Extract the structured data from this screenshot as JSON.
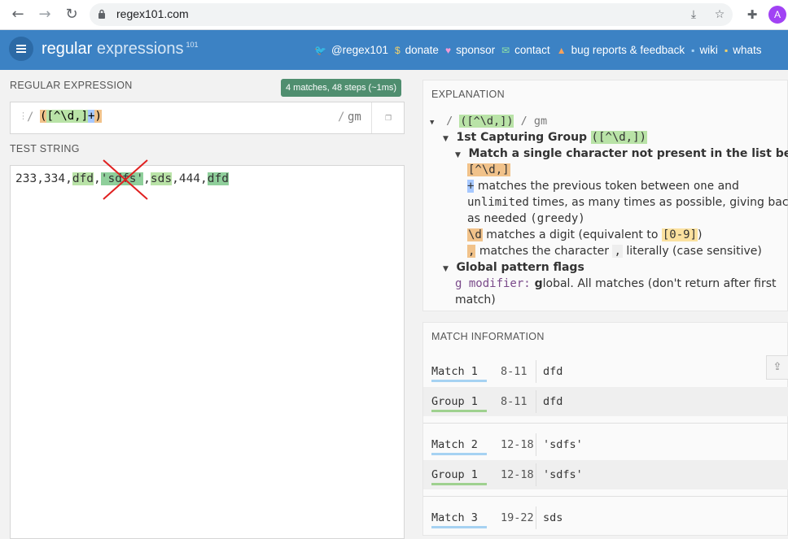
{
  "browser": {
    "url": "regex101.com",
    "avatar_letter": "A"
  },
  "header": {
    "brand_main": "regular",
    "brand_light": "expressions",
    "brand_sup": "101",
    "links": [
      {
        "icon": "twitter-icon",
        "glyph": "🐦",
        "label": "@regex101"
      },
      {
        "icon": "dollar-icon",
        "glyph": "$",
        "label": "donate"
      },
      {
        "icon": "heart-icon",
        "glyph": "♥",
        "label": "sponsor"
      },
      {
        "icon": "mail-icon",
        "glyph": "✉",
        "label": "contact"
      },
      {
        "icon": "warning-icon",
        "glyph": "▲",
        "label": "bug reports & feedback"
      },
      {
        "icon": "wiki-icon",
        "glyph": "▪",
        "label": "wiki"
      },
      {
        "icon": "whatsnew-icon",
        "glyph": "▪",
        "label": "whats"
      }
    ]
  },
  "regex": {
    "section_label": "REGULAR EXPRESSION",
    "badge": "4 matches, 48 steps (~1ms)",
    "delim_left": "/",
    "open_paren": "(",
    "class_text": "[^\\d,]",
    "plus": "+",
    "close_paren": ")",
    "delim_right": "/",
    "flags": "gm"
  },
  "test": {
    "section_label": "TEST STRING",
    "segments": [
      {
        "text": "233,334,",
        "hl": ""
      },
      {
        "text": "dfd",
        "hl": "hl1"
      },
      {
        "text": ",",
        "hl": ""
      },
      {
        "text": "'sdfs'",
        "hl": "hl2"
      },
      {
        "text": ",",
        "hl": ""
      },
      {
        "text": "sds",
        "hl": "hl1"
      },
      {
        "text": ",444,",
        "hl": ""
      },
      {
        "text": "dfd",
        "hl": "hl2"
      }
    ]
  },
  "explanation": {
    "title": "EXPLANATION",
    "root_pattern": "([^\\d,])",
    "root_slash_left": "/",
    "root_slash_right": "/",
    "root_flags": "gm",
    "group_title": "1st Capturing Group",
    "group_code": "([^\\d,])",
    "class_title": "Match a single character not present in the list below",
    "class_code": "[^\\d,]",
    "plus_code": "+",
    "plus_text_1": " matches the previous token between ",
    "plus_one": "one",
    "plus_and": " and",
    "plus_unlimited": "unlimited",
    "plus_text_2": " times, as many times as possible, giving back",
    "plus_text_3": "as needed ",
    "plus_greedy": "(greedy)",
    "d_code": "\\d",
    "d_text": " matches a digit (equivalent to ",
    "d_range": "[0-9]",
    "d_close": ")",
    "comma_code": ",",
    "comma_text_1": " matches the character ",
    "comma_char": ",",
    "comma_text_2": " literally (case sensitive)",
    "flags_title": "Global pattern flags",
    "flag_g": "g modifier:",
    "flag_g_bold": " g",
    "flag_g_text": "lobal. All matches (don't return after first",
    "flag_g_text2": "match)"
  },
  "match_info": {
    "title": "MATCH INFORMATION",
    "rows": [
      {
        "label": "Match 1",
        "range": "8-11",
        "value": "dfd",
        "kind": "match"
      },
      {
        "label": "Group 1",
        "range": "8-11",
        "value": "dfd",
        "kind": "group"
      },
      {
        "label": "Match 2",
        "range": "12-18",
        "value": "'sdfs'",
        "kind": "match"
      },
      {
        "label": "Group 1",
        "range": "12-18",
        "value": "'sdfs'",
        "kind": "group"
      },
      {
        "label": "Match 3",
        "range": "19-22",
        "value": "sds",
        "kind": "match"
      }
    ],
    "colors": {
      "match_bar": "#a6d2f2",
      "group_bar": "#9fd18f"
    }
  }
}
